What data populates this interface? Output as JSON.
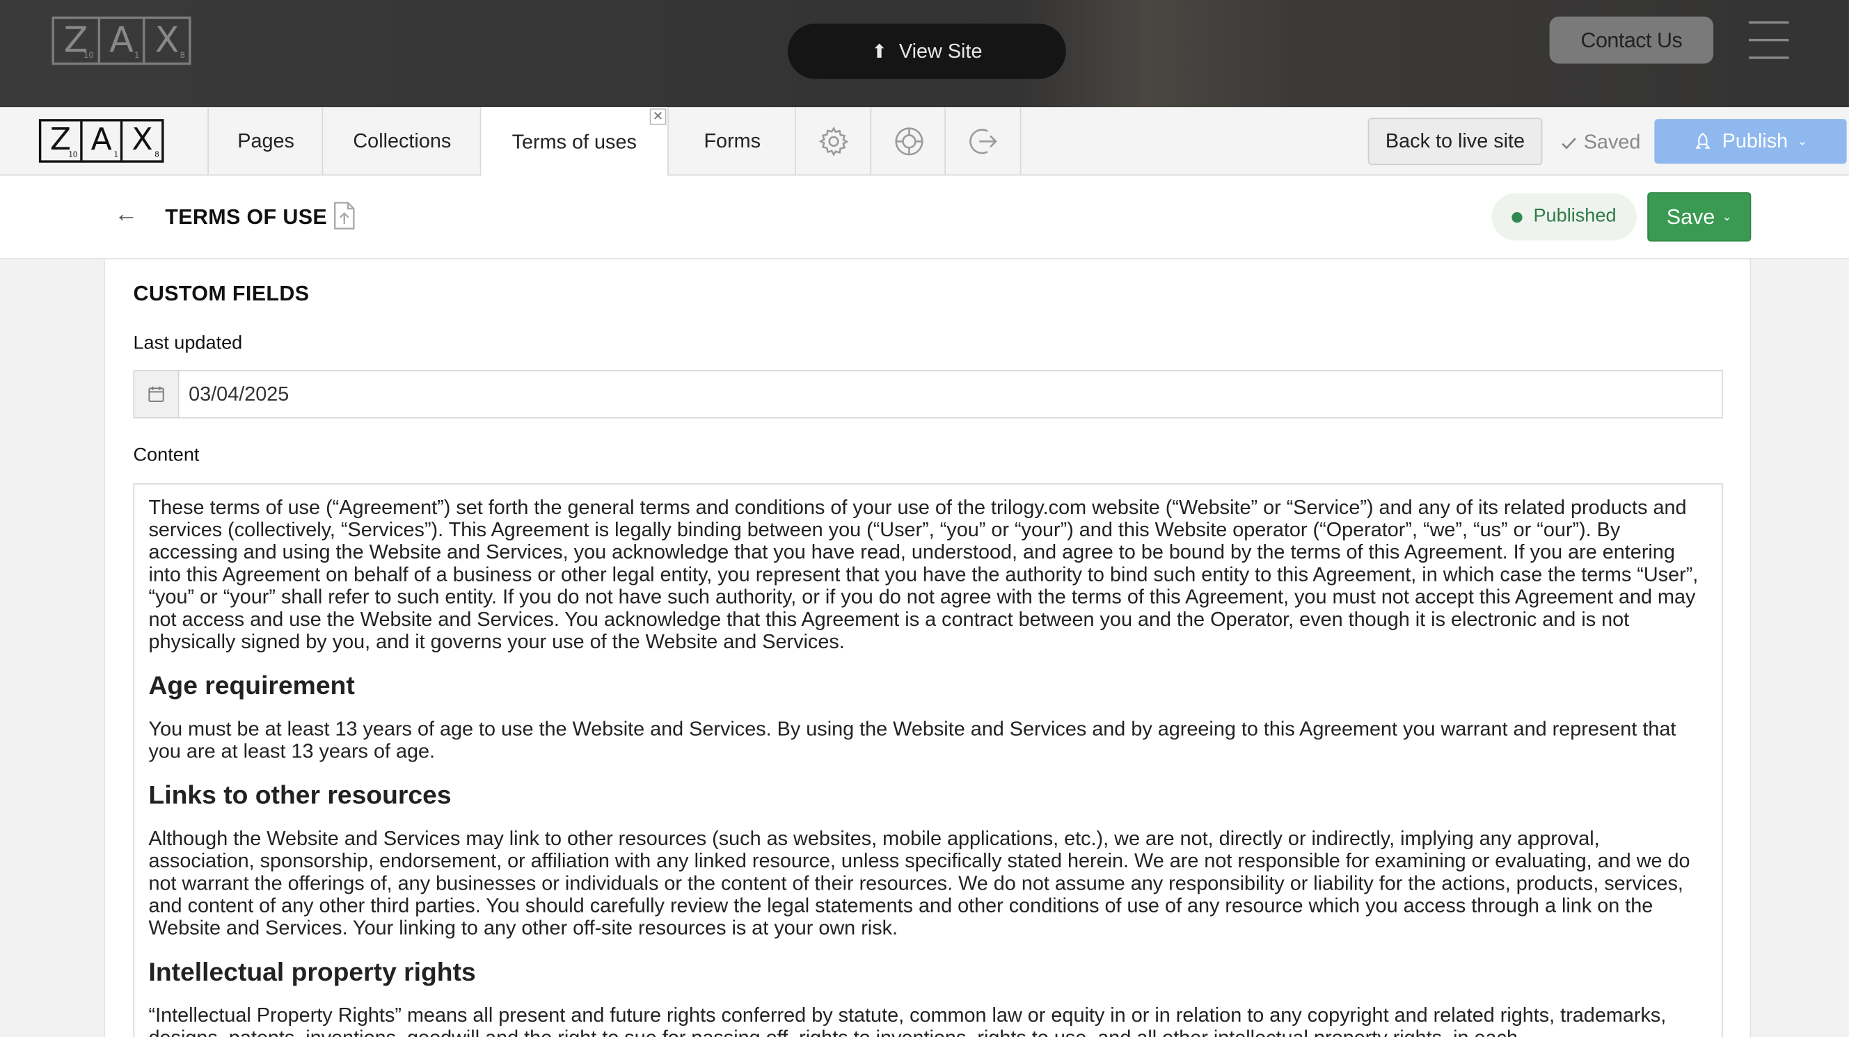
{
  "site_header": {
    "logo_letters": [
      {
        "letter": "Z",
        "sub": "10"
      },
      {
        "letter": "A",
        "sub": "1"
      },
      {
        "letter": "X",
        "sub": "8"
      }
    ],
    "view_site_label": "View Site",
    "contact_label": "Contact Us"
  },
  "cms_bar": {
    "tabs": [
      {
        "label": "Pages"
      },
      {
        "label": "Collections"
      },
      {
        "label": "Terms of uses"
      },
      {
        "label": "Forms"
      }
    ],
    "icon_tabs": [
      "gear-icon",
      "help-lifebuoy-icon",
      "logout-icon"
    ],
    "back_to_live_label": "Back to live site",
    "saved_label": "Saved",
    "publish_label": "Publish"
  },
  "page_header": {
    "title": "TERMS OF USE",
    "status": "Published",
    "save_label": "Save"
  },
  "custom_fields": {
    "section_title": "CUSTOM FIELDS",
    "last_updated_label": "Last updated",
    "last_updated_value": "03/04/2025",
    "content_label": "Content"
  },
  "content": {
    "intro": "These terms of use (“Agreement”) set forth the general terms and conditions of your use of the trilogy.com website (“Website” or “Service”) and any of its related products and services (collectively, “Services”). This Agreement is legally binding between you (“User”, “you” or “your”) and this Website operator (“Operator”, “we”, “us” or “our”). By accessing and using the Website and Services, you acknowledge that you have read, understood, and agree to be bound by the terms of this Agreement. If you are entering into this Agreement on behalf of a business or other legal entity, you represent that you have the authority to bind such entity to this Agreement, in which case the terms “User”, “you” or “your” shall refer to such entity. If you do not have such authority, or if you do not agree with the terms of this Agreement, you must not accept this Agreement and may not access and use the Website and Services. You acknowledge that this Agreement is a contract between you and the Operator, even though it is electronic and is not physically signed by you, and it governs your use of the Website and Services.",
    "h_age": "Age requirement",
    "p_age": "You must be at least 13 years of age to use the Website and Services. By using the Website and Services and by agreeing to this Agreement you warrant and represent that you are at least 13 years of age.",
    "h_links": "Links to other resources",
    "p_links": "Although the Website and Services may link to other resources (such as websites, mobile applications, etc.), we are not, directly or indirectly, implying any approval, association, sponsorship, endorsement, or affiliation with any linked resource, unless specifically stated herein. We are not responsible for examining or evaluating, and we do not warrant the offerings of, any businesses or individuals or the content of their resources. We do not assume any responsibility or liability for the actions, products, services, and content of any other third parties. You should carefully review the legal statements and other conditions of use of any resource which you access through a link on the Website and Services. Your linking to any other off-site resources is at your own risk.",
    "h_ip": "Intellectual property rights",
    "p_ip": "“Intellectual Property Rights” means all present and future rights conferred by statute, common law or equity in or in relation to any copyright and related rights, trademarks, designs, patents, inventions, goodwill and the right to sue for passing off, rights to inventions, rights to use, and all other intellectual property rights, in each"
  },
  "colors": {
    "publish_bg": "#8fb8ef",
    "save_bg": "#3a9a51",
    "status_text": "#2f7a47"
  }
}
